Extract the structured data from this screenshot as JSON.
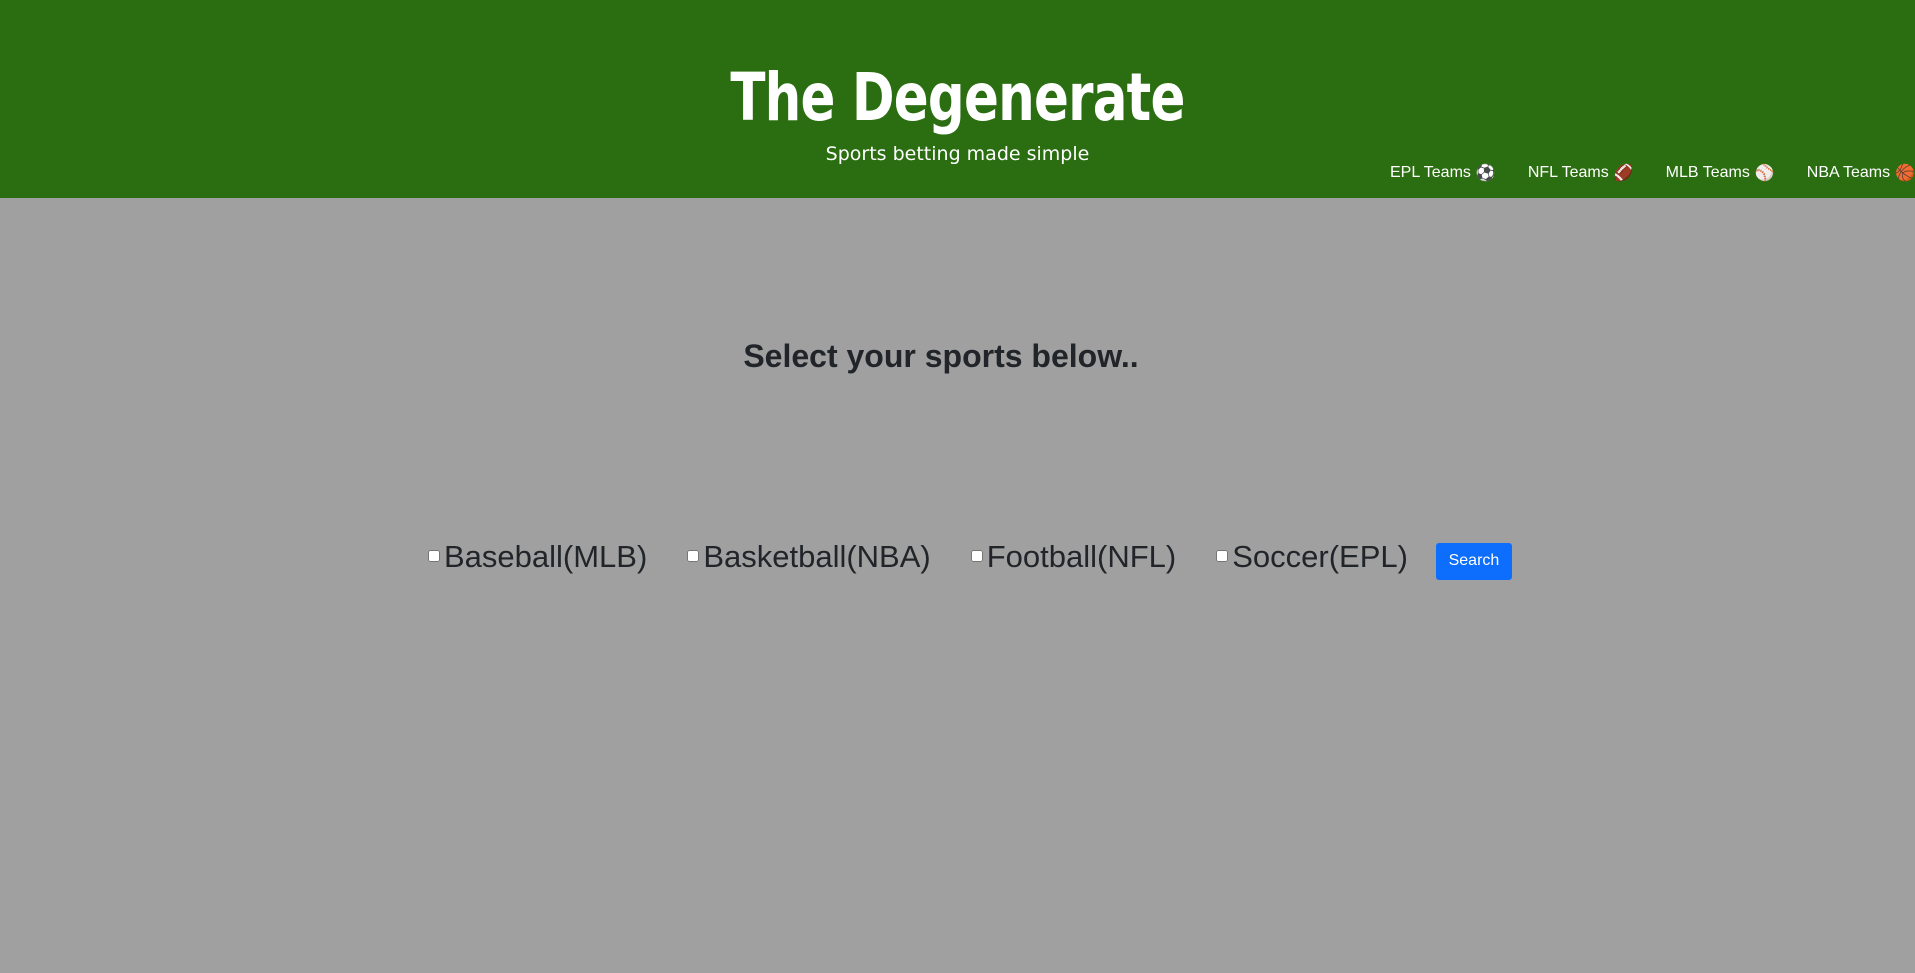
{
  "header": {
    "title": "The Degenerate",
    "tagline": "Sports betting made simple",
    "bg_color": "#2a6e11"
  },
  "nav": {
    "items": [
      {
        "label": "EPL Teams",
        "icon": "⚽",
        "icon_name": "soccer-ball-icon"
      },
      {
        "label": "NFL Teams",
        "icon": "🏈",
        "icon_name": "football-icon"
      },
      {
        "label": "MLB Teams",
        "icon": "⚾",
        "icon_name": "baseball-icon"
      },
      {
        "label": "NBA Teams",
        "icon": "🏀",
        "icon_name": "basketball-icon"
      }
    ]
  },
  "main": {
    "prompt": "Select your sports below..",
    "sports": [
      {
        "label": "Baseball(MLB)",
        "checked": false
      },
      {
        "label": "Basketball(NBA)",
        "checked": false
      },
      {
        "label": "Football(NFL)",
        "checked": false
      },
      {
        "label": "Soccer(EPL)",
        "checked": false
      }
    ],
    "search_label": "Search",
    "accent_color": "#0d6efd",
    "bg_color": "#a0a0a0"
  }
}
